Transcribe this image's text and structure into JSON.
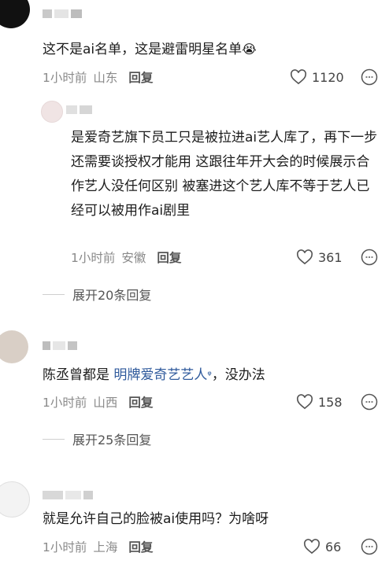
{
  "comments": [
    {
      "content": "这不是ai名单，这是避雷明星名单",
      "emoji": "😭",
      "time": "1小时前",
      "location": "山东",
      "reply_label": "回复",
      "likes": "1120"
    },
    {
      "content": "是爱奇艺旗下员工只是被拉进ai艺人库了，再下一步还需要谈授权才能用 这跟往年开大会的时候展示合作艺人没任何区别 被塞进这个艺人库不等于艺人已经可以被用作ai剧里",
      "time": "1小时前",
      "location": "安徽",
      "reply_label": "回复",
      "likes": "361"
    },
    {
      "content_before": "陈丞曾都是 ",
      "link_text": "明牌爱奇艺艺人",
      "search_mark": "ᵠ",
      "content_after": "，没办法",
      "time": "1小时前",
      "location": "山西",
      "reply_label": "回复",
      "likes": "158"
    },
    {
      "content": "就是允许自己的脸被ai使用吗？为啥呀",
      "time": "1小时前",
      "location": "上海",
      "reply_label": "回复",
      "likes": "66"
    }
  ],
  "expand_1": "展开20条回复",
  "expand_2": "展开25条回复"
}
